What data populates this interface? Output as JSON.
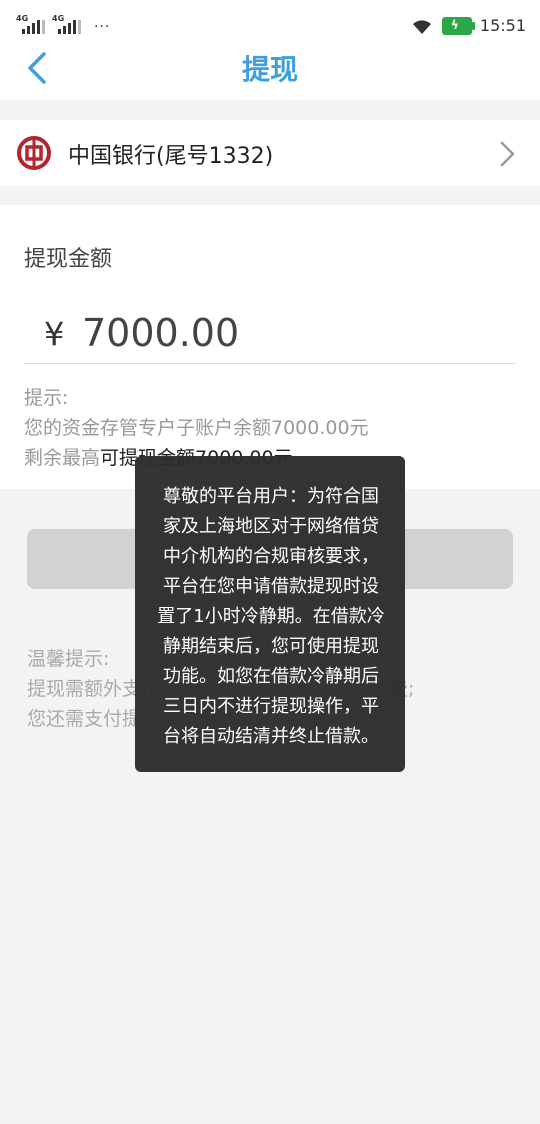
{
  "status_bar": {
    "network_1": "4G",
    "network_2": "4G",
    "more": "···",
    "time": "15:51"
  },
  "header": {
    "title": "提现"
  },
  "bank": {
    "name": "中国银行(尾号1332)"
  },
  "amount": {
    "label": "提现金额",
    "currency": "¥",
    "value": "7000.00"
  },
  "hint": {
    "head": "提示:",
    "line1": "您的资金存管专户子账户余额7000.00元",
    "line2_prefix": "剩余最高",
    "line2_rest": "可提现金额7000.00元"
  },
  "tips": {
    "head": "温馨提示:",
    "line1": "提现需额外支付",
    "line1_tail": "费;",
    "line2": "您还需支付提现"
  },
  "toast": {
    "message": "尊敬的平台用户：为符合国家及上海地区对于网络借贷中介机构的合规审核要求，平台在您申请借款提现时设置了1小时冷静期。在借款冷静期结束后，您可使用提现功能。如您在借款冷静期后三日内不进行提现操作，平台将自动结清并终止借款。"
  },
  "colors": {
    "accent": "#3d9fe0",
    "bank_red": "#b3262e",
    "battery": "#2aa84a",
    "button_disabled": "#d2d2d2"
  }
}
